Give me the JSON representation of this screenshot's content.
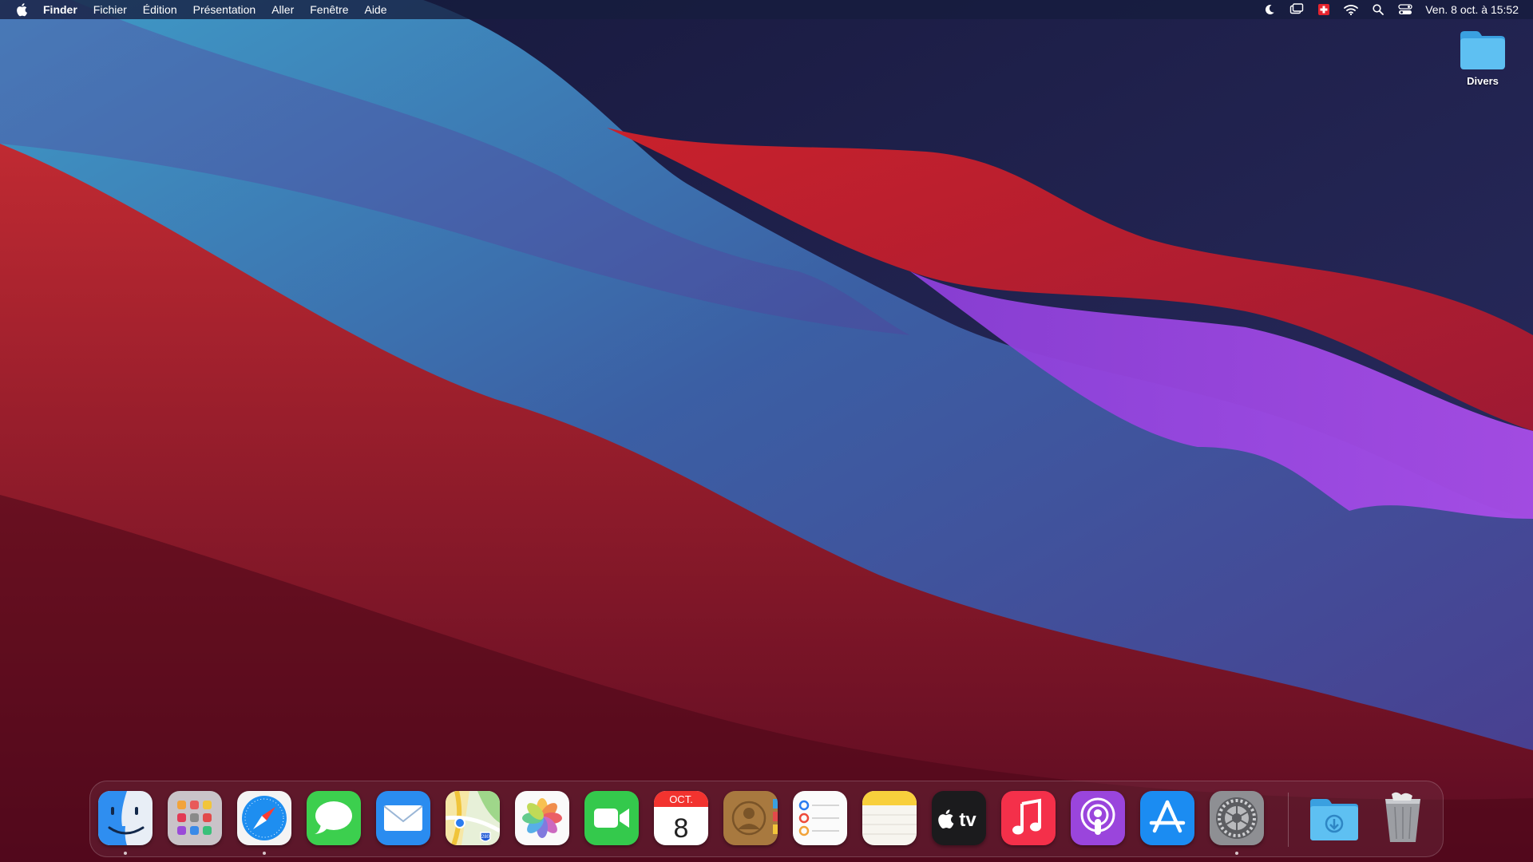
{
  "menubar": {
    "app_name": "Finder",
    "menus": [
      "Fichier",
      "Édition",
      "Présentation",
      "Aller",
      "Fenêtre",
      "Aide"
    ],
    "tray_icons": [
      "moon-icon",
      "screen-mirroring-icon",
      "swiss-flag-icon",
      "wifi-icon",
      "search-icon",
      "control-center-icon"
    ],
    "clock": "Ven. 8 oct. à 15:52"
  },
  "desktop": {
    "folder_label": "Divers"
  },
  "dock": {
    "apps": [
      {
        "name": "Finder",
        "icon": "finder-icon",
        "running": true
      },
      {
        "name": "Launchpad",
        "icon": "launchpad-icon",
        "running": false
      },
      {
        "name": "Safari",
        "icon": "safari-icon",
        "running": true
      },
      {
        "name": "Messages",
        "icon": "messages-icon",
        "running": false
      },
      {
        "name": "Mail",
        "icon": "mail-icon",
        "running": false
      },
      {
        "name": "Plans",
        "icon": "maps-icon",
        "running": false
      },
      {
        "name": "Photos",
        "icon": "photos-icon",
        "running": false
      },
      {
        "name": "FaceTime",
        "icon": "facetime-icon",
        "running": false
      },
      {
        "name": "Calendrier",
        "icon": "calendar-icon",
        "running": false
      },
      {
        "name": "Contacts",
        "icon": "contacts-icon",
        "running": false
      },
      {
        "name": "Rappels",
        "icon": "reminders-icon",
        "running": false
      },
      {
        "name": "Notes",
        "icon": "notes-icon",
        "running": false
      },
      {
        "name": "TV",
        "icon": "apple-tv-icon",
        "running": false
      },
      {
        "name": "Musique",
        "icon": "music-icon",
        "running": false
      },
      {
        "name": "Podcasts",
        "icon": "podcasts-icon",
        "running": false
      },
      {
        "name": "App Store",
        "icon": "app-store-icon",
        "running": false
      },
      {
        "name": "Préférences Système",
        "icon": "system-preferences-icon",
        "running": true
      }
    ],
    "calendar_month": "OCT.",
    "calendar_day": "8",
    "maps_shield": "280",
    "tv_text": "tv",
    "downloads_icon": "downloads-folder-icon",
    "trash_icon": "trash-icon"
  },
  "colors": {
    "menubar_bg": "#161c3e",
    "folder_blue": "#4fb3ec",
    "wallpaper_red": "#c1272d",
    "wallpaper_blue": "#3c96c2",
    "wallpaper_purple": "#a646e6",
    "wallpaper_navy": "#1c1d42"
  }
}
